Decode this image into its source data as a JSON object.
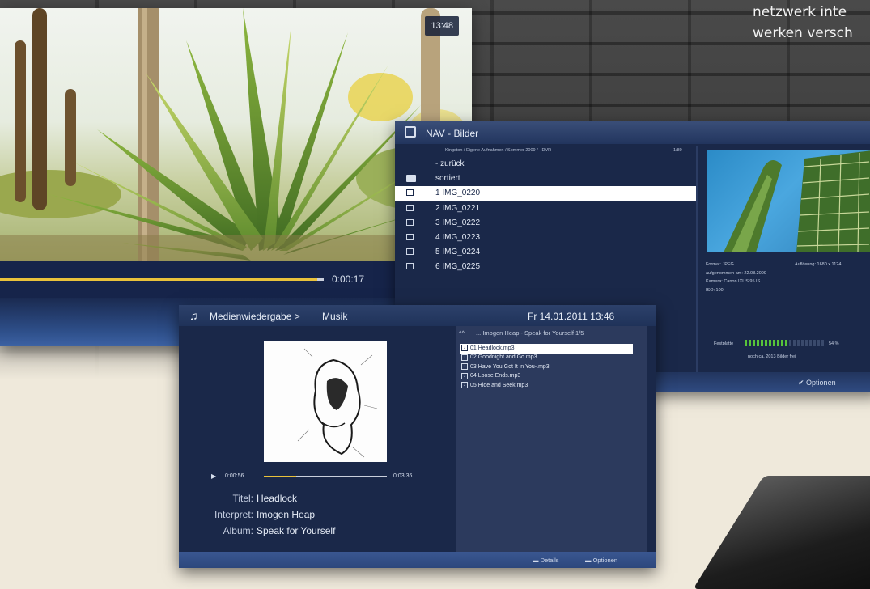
{
  "background": {
    "text_lines": [
      "netzwerk inte",
      "werken versch"
    ]
  },
  "video_player": {
    "clock": "13:48",
    "elapsed": "0:00:17",
    "progress": 0.98
  },
  "image_browser": {
    "title": "NAV - Bilder",
    "path": "Kingston / Eigene Aufnahmen / Sommer 2009 / - DVR",
    "count": "1/80",
    "rows": [
      {
        "icon": "back-icon",
        "label": "- zurück",
        "selected": false
      },
      {
        "icon": "folder-icon",
        "label": "sortiert",
        "selected": false
      },
      {
        "icon": "image-icon",
        "label": "1 IMG_0220",
        "selected": true
      },
      {
        "icon": "image-icon",
        "label": "2 IMG_0221",
        "selected": false
      },
      {
        "icon": "image-icon",
        "label": "3 IMG_0222",
        "selected": false
      },
      {
        "icon": "image-icon",
        "label": "4 IMG_0223",
        "selected": false
      },
      {
        "icon": "image-icon",
        "label": "5 IMG_0224",
        "selected": false
      },
      {
        "icon": "image-icon",
        "label": "6 IMG_0225",
        "selected": false
      }
    ],
    "info": {
      "format": "Format: JPEG",
      "resolution": "Auflösung: 1680 x 1124",
      "recorded": "aufgenommen am: 22.08.2009",
      "camera": "Kamera: Canon IXUS 95 IS",
      "iso": "ISO: 100"
    },
    "disk": {
      "label": "Festplatte",
      "percent_label": "54 %",
      "fill": 0.54,
      "free_text": "noch ca. 2013 Bilder frei"
    },
    "options_label": "Optionen"
  },
  "music_player": {
    "breadcrumb": "Medienwiedergabe",
    "section": "Musik",
    "datetime": "Fr 14.01.2011 13:46",
    "elapsed": "0:00:56",
    "total": "0:03:36",
    "progress": 0.26,
    "metadata": [
      {
        "key": "Titel:",
        "value": "Headlock"
      },
      {
        "key": "Interpret:",
        "value": "Imogen Heap"
      },
      {
        "key": "Album:",
        "value": "Speak for Yourself"
      }
    ],
    "playlist_header": "... Imogen Heap - Speak for Yourself 1/5",
    "playlist": [
      {
        "label": "01 Headlock.mp3",
        "selected": true
      },
      {
        "label": "02 Goodnight and Go.mp3",
        "selected": false
      },
      {
        "label": "03 Have You Got It in You-.mp3",
        "selected": false
      },
      {
        "label": "04 Loose Ends.mp3",
        "selected": false
      },
      {
        "label": "05 Hide and Seek.mp3",
        "selected": false
      }
    ],
    "footer": {
      "details": "Details",
      "options": "Optionen"
    }
  },
  "colors": {
    "window_bg": "#1a2849",
    "accent_progress": "#e9c23b",
    "disk_green": "#57c33a"
  }
}
